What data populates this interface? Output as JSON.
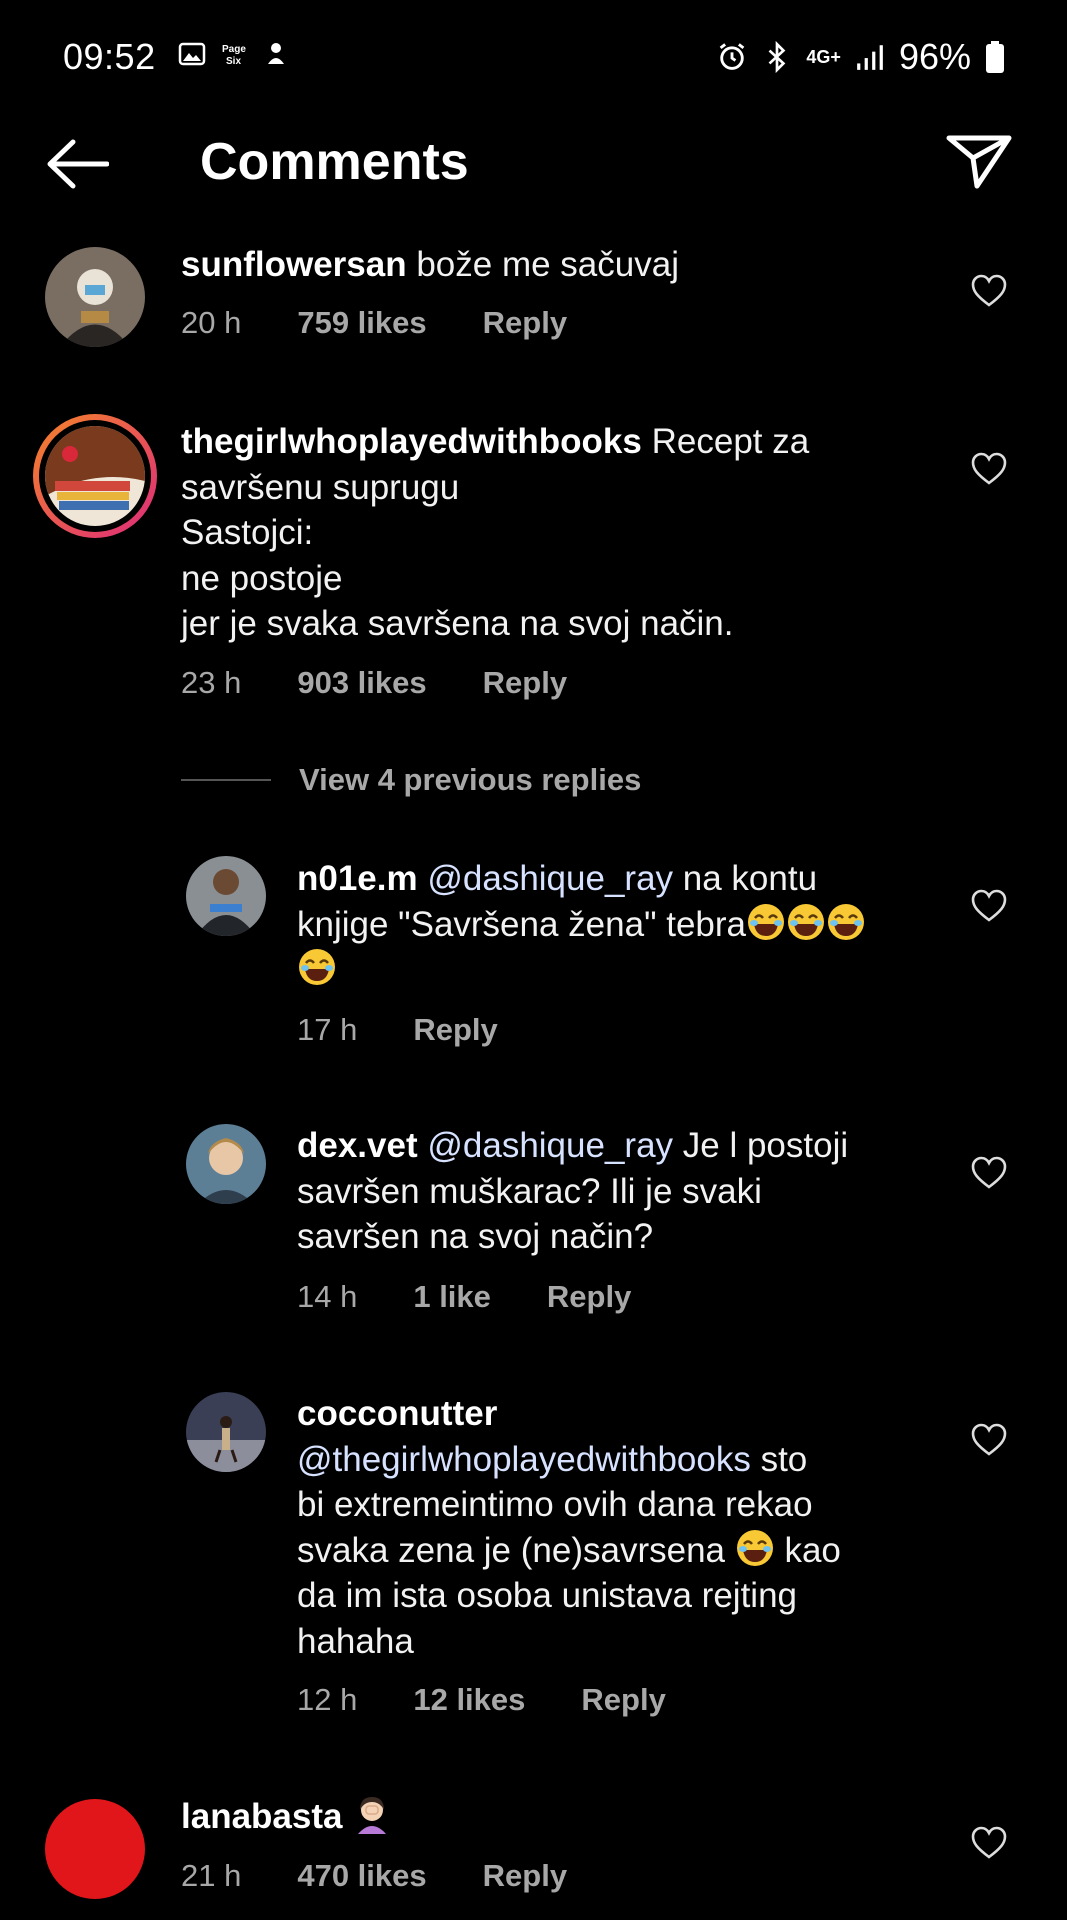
{
  "status_bar": {
    "time": "09:52",
    "network": "4G+",
    "battery": "96%"
  },
  "header": {
    "title": "Comments"
  },
  "comments": [
    {
      "user": "sunflowersan",
      "text": "bože me sačuvaj",
      "time": "20 h",
      "likes": "759 likes",
      "reply": "Reply"
    },
    {
      "user": "thegirlwhoplayedwithbooks",
      "text_lines": [
        "Recept za",
        "savršenu suprugu",
        "Sastojci:",
        "ne postoje",
        "jer je svaka savršena na svoj način."
      ],
      "time": "23 h",
      "likes": "903 likes",
      "reply": "Reply"
    }
  ],
  "view_previous": "View 4 previous replies",
  "replies": [
    {
      "user": "n01e.m",
      "mention": "@dashique_ray",
      "text1": "na kontu",
      "text2": "knjige \"Savršena žena\" tebra",
      "time": "17 h",
      "reply": "Reply"
    },
    {
      "user": "dex.vet",
      "mention": "@dashique_ray",
      "text1": "Je l postoji",
      "text2": "savršen muškarac? Ili je svaki",
      "text3": "savršen na svoj način?",
      "time": "14 h",
      "likes": "1 like",
      "reply": "Reply"
    },
    {
      "user": "cocconutter",
      "mention": "@thegirlwhoplayedwithbooks",
      "text1": "sto",
      "text2": "bi extremeintimo ovih dana rekao",
      "text3a": "svaka zena je (ne)savrsena",
      "text3b": "kao",
      "text4": "da im ista osoba unistava rejting",
      "text5": "hahaha",
      "time": "12 h",
      "likes": "12 likes",
      "reply": "Reply"
    }
  ],
  "last_comment": {
    "user": "lanabasta",
    "time": "21 h",
    "likes": "470 likes",
    "reply": "Reply"
  },
  "colors": {
    "background": "#000000",
    "secondary_text": "#a8a8a8",
    "mention": "#d6e2ff",
    "story_ring_start": "#f58529",
    "story_ring_end": "#dd2a7b",
    "last_avatar": "#e0161a"
  }
}
